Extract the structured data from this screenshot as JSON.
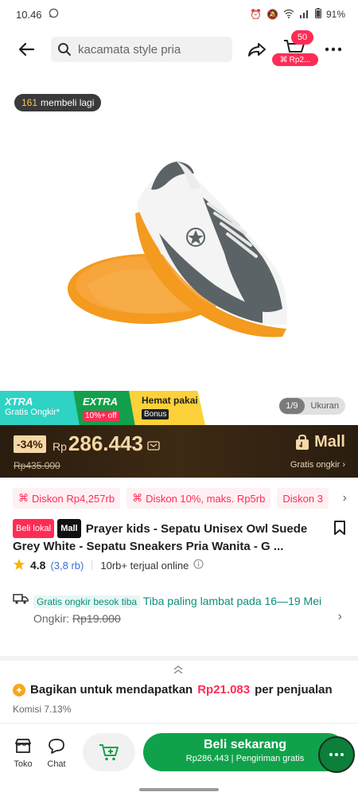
{
  "status_bar": {
    "time": "10.46",
    "battery": "91%"
  },
  "header": {
    "search_placeholder": "kacamata style pria",
    "cart_count": "50",
    "cart_tag": "Rp2..."
  },
  "hero": {
    "buyers_count": "161",
    "buyers_text": "membeli lagi",
    "image_counter": "1/9",
    "image_size_label": "Ukuran"
  },
  "promos": {
    "xtra_title": "XTRA",
    "xtra_sub": "Gratis Ongkir*",
    "extra_title": "EXTRA",
    "extra_sub": "10%+ off",
    "hemat_title": "Hemat pakai",
    "hemat_sub": "Bonus"
  },
  "price": {
    "discount": "-34%",
    "currency": "Rp",
    "value": "286.443",
    "old": "Rp435.000",
    "mall_label": "Mall",
    "shipping_note": "Gratis ongkir ›"
  },
  "vouchers": [
    {
      "label": "Diskon Rp4,257rb"
    },
    {
      "label": "Diskon 10%, maks. Rp5rb"
    },
    {
      "label": "Diskon 3"
    }
  ],
  "product": {
    "tag_local": "Beli lokal",
    "tag_mall": "Mall",
    "title": "Prayer kids - Sepatu Unisex Owl Suede Grey White - Sepatu Sneakers Pria Wanita - G ...",
    "rating": "4.8",
    "rating_count": "(3,8 rb)",
    "sold": "10rb+ terjual online"
  },
  "shipping": {
    "free_tag": "Gratis ongkir besok tiba",
    "eta": "Tiba paling lambat pada 16—19 Mei",
    "cost_label": "Ongkir:",
    "cost_old": "Rp19.000"
  },
  "affiliate": {
    "text": "Bagikan untuk mendapatkan",
    "amount": "Rp21.083",
    "suffix": "per penjualan",
    "rate": "Komisi 7.13%"
  },
  "bottom_bar": {
    "store_label": "Toko",
    "chat_label": "Chat",
    "buy_label": "Beli sekarang",
    "buy_price": "Rp286.443",
    "buy_sub": "Pengiriman gratis"
  },
  "colors": {
    "accent_red": "#fe2c55",
    "buy_green": "#10a24b",
    "teal": "#0a8f7d",
    "gold": "#f6d7a7"
  }
}
